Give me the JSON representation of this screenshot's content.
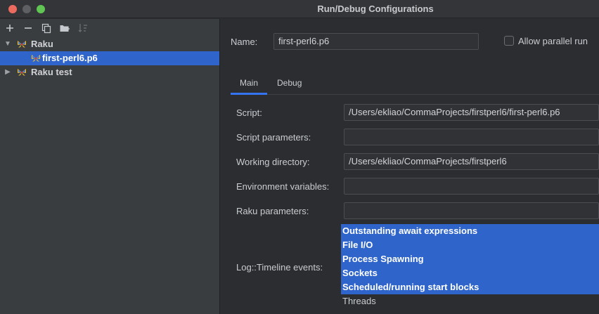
{
  "window": {
    "title": "Run/Debug Configurations"
  },
  "toolbar": {
    "add_icon": "plus-icon",
    "remove_icon": "minus-icon",
    "copy_icon": "copy-icon",
    "folder_icon": "new-folder-icon",
    "sort_icon": "sort-icon"
  },
  "tree": {
    "groups": [
      {
        "label": "Raku",
        "expanded": true,
        "children": [
          {
            "label": "first-perl6.p6",
            "selected": true
          }
        ]
      },
      {
        "label": "Raku test",
        "expanded": false,
        "children": []
      }
    ]
  },
  "config": {
    "name_label": "Name:",
    "name_value": "first-perl6.p6",
    "allow_parallel_label": "Allow parallel run",
    "allow_parallel_checked": false,
    "tabs": [
      {
        "label": "Main",
        "active": true
      },
      {
        "label": "Debug",
        "active": false
      }
    ],
    "fields": {
      "script_label": "Script:",
      "script_value": "/Users/ekliao/CommaProjects/firstperl6/first-perl6.p6",
      "script_params_label": "Script parameters:",
      "script_params_value": "",
      "working_dir_label": "Working directory:",
      "working_dir_value": "/Users/ekliao/CommaProjects/firstperl6",
      "env_vars_label": "Environment variables:",
      "env_vars_value": "",
      "raku_params_label": "Raku parameters:",
      "raku_params_value": "",
      "timeline_label": "Log::Timeline events:"
    },
    "timeline_events": [
      {
        "label": "Outstanding await expressions",
        "selected": true
      },
      {
        "label": "File I/O",
        "selected": true
      },
      {
        "label": "Process Spawning",
        "selected": true
      },
      {
        "label": "Sockets",
        "selected": true
      },
      {
        "label": "Scheduled/running start blocks",
        "selected": true
      },
      {
        "label": "Threads",
        "selected": false
      }
    ]
  },
  "colors": {
    "selection": "#2f65ca",
    "accent": "#3574f0",
    "close": "#ed6a5e",
    "maximize": "#61c554"
  }
}
